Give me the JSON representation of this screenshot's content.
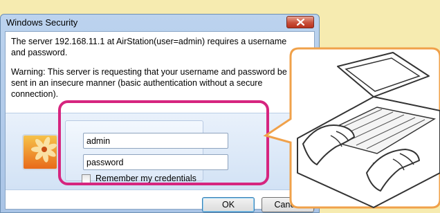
{
  "dialog": {
    "title": "Windows Security",
    "message": "The server 192.168.11.1 at AirStation(user=admin) requires a username and password.",
    "warning": "Warning: This server is requesting that your username and password be sent in an insecure manner (basic authentication without a secure connection).",
    "username_value": "admin",
    "password_value": "password",
    "remember_label": "Remember my credentials",
    "ok_label": "OK",
    "cancel_label": "Cancel"
  },
  "icons": {
    "close": "close-icon",
    "user_tile": "user-tile-icon",
    "illustration": "typing-laptop-illustration"
  },
  "colors": {
    "background": "#f6ebb0",
    "highlight": "#d6257f",
    "callout_border": "#f0a14a"
  }
}
